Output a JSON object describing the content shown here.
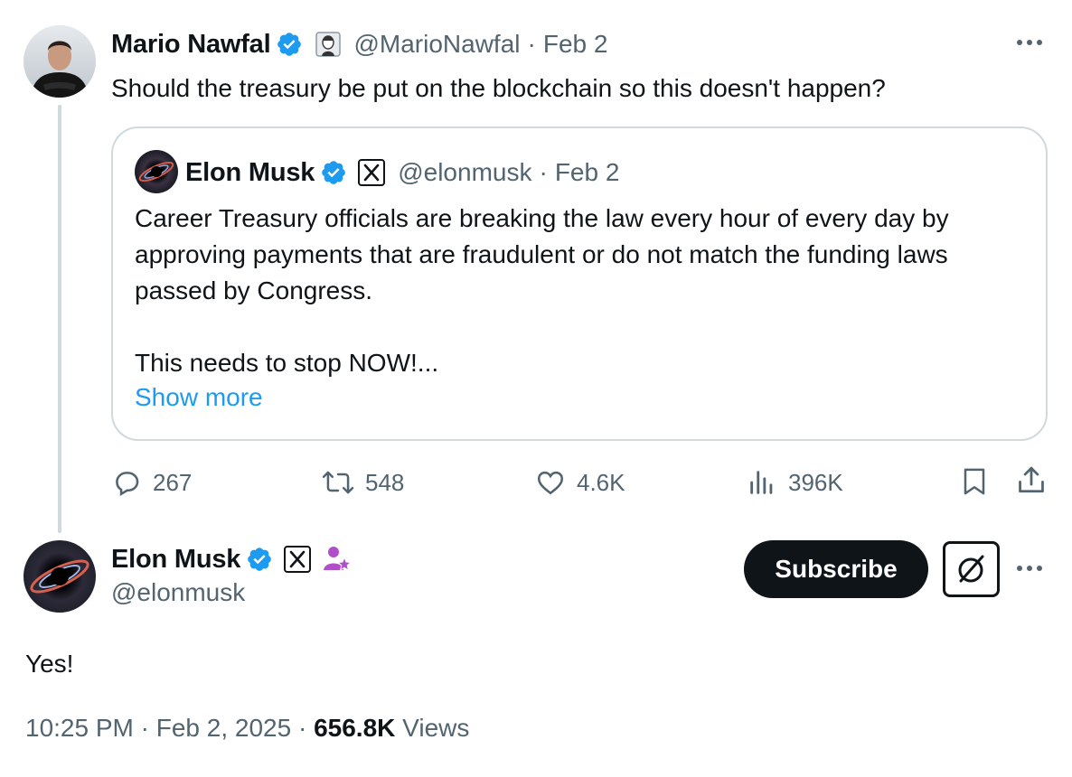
{
  "parent_tweet": {
    "author_name": "Mario Nawfal",
    "handle": "@MarioNawfal",
    "separator": "·",
    "date": "Feb 2",
    "text": "Should the treasury be put on the blockchain so this doesn't happen?",
    "more_icon": "more-horizontal-icon",
    "quoted": {
      "author_name": "Elon Musk",
      "handle": "@elonmusk",
      "separator": "·",
      "date": "Feb 2",
      "paragraph1": "Career Treasury officials are breaking the law every hour of every day by approving payments that are fraudulent or do not match the funding laws passed by Congress.",
      "paragraph2": "This needs to stop NOW!...",
      "show_more": "Show more"
    },
    "actions": {
      "replies": "267",
      "reposts": "548",
      "likes": "4.6K",
      "views": "396K"
    }
  },
  "main_tweet": {
    "author_name": "Elon Musk",
    "handle": "@elonmusk",
    "subscribe_label": "Subscribe",
    "text": "Yes!",
    "time": "10:25 PM",
    "sep1": "·",
    "date": "Feb 2, 2025",
    "sep2": "·",
    "views_count": "656.8K",
    "views_label": "Views"
  },
  "colors": {
    "accent": "#1d9bf0",
    "text": "#0f1419",
    "muted": "#536471",
    "border": "#cfd9de",
    "verified": "#1d9bf0",
    "affiliate_badge": "#b14fc9"
  }
}
